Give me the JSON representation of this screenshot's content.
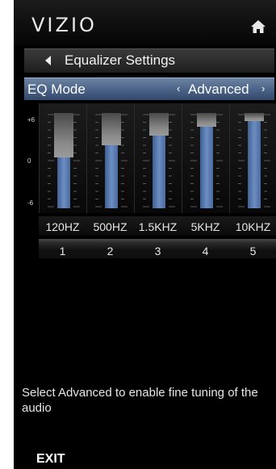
{
  "header": {
    "logo": "VIZIO"
  },
  "title_bar": {
    "title": "Equalizer Settings"
  },
  "eq_mode": {
    "label": "EQ Mode",
    "value": "Advanced",
    "left_arrow": "‹",
    "right_arrow": "›"
  },
  "scale": {
    "top": "+6",
    "middle": "0",
    "bottom": "-6"
  },
  "bands": [
    {
      "freq": "120HZ",
      "number": "1",
      "level": 0.55
    },
    {
      "freq": "500HZ",
      "number": "2",
      "level": 0.68
    },
    {
      "freq": "1.5KHZ",
      "number": "3",
      "level": 0.78
    },
    {
      "freq": "5KHZ",
      "number": "4",
      "level": 0.87
    },
    {
      "freq": "10KHZ",
      "number": "5",
      "level": 0.93
    }
  ],
  "help": {
    "text": "Select Advanced to enable fine tuning of the audio"
  },
  "footer": {
    "exit_label": "EXIT"
  },
  "icons": {
    "home": "home-icon",
    "back": "back-arrow-icon"
  },
  "colors": {
    "accent": "#4a6286",
    "fill": "#5d7fb5",
    "background": "#000000"
  }
}
